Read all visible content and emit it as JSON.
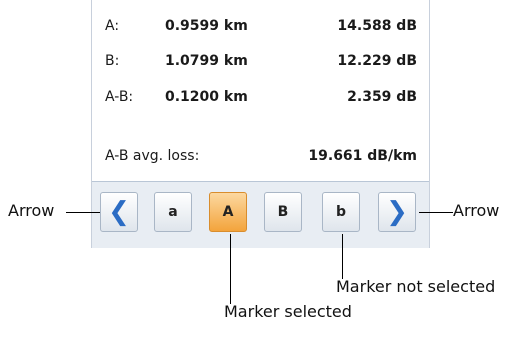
{
  "readouts": {
    "a": {
      "label": "A:",
      "distance": "0.9599 km",
      "loss": "14.588 dB"
    },
    "b": {
      "label": "B:",
      "distance": "1.0799 km",
      "loss": "12.229 dB"
    },
    "ab": {
      "label": "A-B:",
      "distance": "0.1200 km",
      "loss": "2.359 dB"
    },
    "avg": {
      "label": "A-B avg. loss:",
      "value": "19.661 dB/km"
    }
  },
  "buttons": {
    "prev": "❮",
    "a_small": "a",
    "a_big": "A",
    "b_big": "B",
    "b_small": "b",
    "next": "❯"
  },
  "callouts": {
    "left_arrow": "Arrow",
    "right_arrow": "Arrow",
    "not_selected": "Marker not selected",
    "selected": "Marker selected"
  },
  "colors": {
    "selected_marker": "#f3a43c",
    "arrow": "#2b6cc4"
  }
}
